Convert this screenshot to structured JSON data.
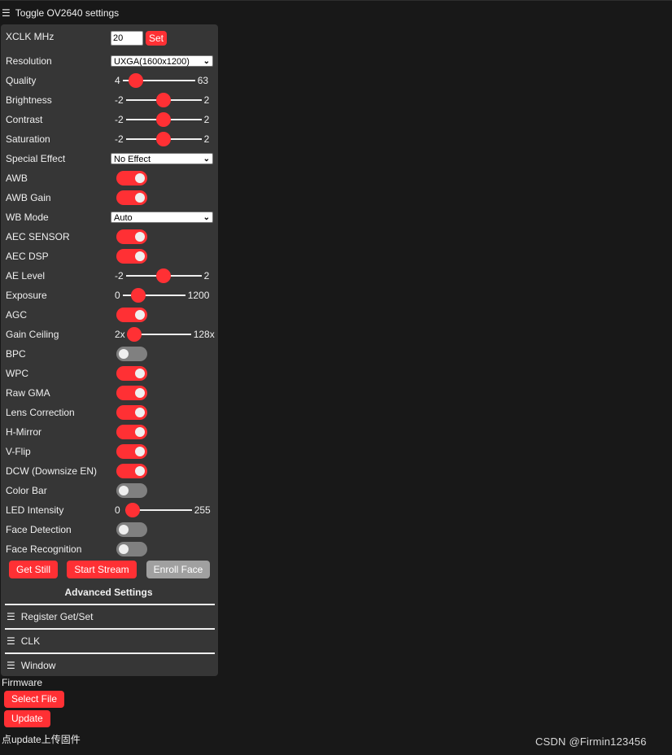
{
  "header": {
    "toggle_label": "Toggle OV2640 settings"
  },
  "xclk": {
    "label": "XCLK MHz",
    "value": "20",
    "button": "Set"
  },
  "resolution": {
    "label": "Resolution",
    "value": "UXGA(1600x1200)"
  },
  "quality": {
    "label": "Quality",
    "min": "4",
    "max": "63",
    "value": 10
  },
  "brightness": {
    "label": "Brightness",
    "min": "-2",
    "max": "2",
    "value": 0
  },
  "contrast": {
    "label": "Contrast",
    "min": "-2",
    "max": "2",
    "value": 0
  },
  "saturation": {
    "label": "Saturation",
    "min": "-2",
    "max": "2",
    "value": 0
  },
  "special_effect": {
    "label": "Special Effect",
    "value": "No Effect"
  },
  "awb": {
    "label": "AWB",
    "on": true
  },
  "awb_gain": {
    "label": "AWB Gain",
    "on": true
  },
  "wb_mode": {
    "label": "WB Mode",
    "value": "Auto"
  },
  "aec_sensor": {
    "label": "AEC SENSOR",
    "on": true
  },
  "aec_dsp": {
    "label": "AEC DSP",
    "on": true
  },
  "ae_level": {
    "label": "AE Level",
    "min": "-2",
    "max": "2",
    "value": 0
  },
  "exposure": {
    "label": "Exposure",
    "min": "0",
    "max": "1200",
    "value": 204
  },
  "agc": {
    "label": "AGC",
    "on": true
  },
  "gain_ceiling": {
    "label": "Gain Ceiling",
    "min": "2x",
    "max": "128x",
    "value": 0
  },
  "bpc": {
    "label": "BPC",
    "on": false
  },
  "wpc": {
    "label": "WPC",
    "on": true
  },
  "raw_gma": {
    "label": "Raw GMA",
    "on": true
  },
  "lens_correction": {
    "label": "Lens Correction",
    "on": true
  },
  "h_mirror": {
    "label": "H-Mirror",
    "on": true
  },
  "v_flip": {
    "label": "V-Flip",
    "on": true
  },
  "dcw": {
    "label": "DCW (Downsize EN)",
    "on": true
  },
  "color_bar": {
    "label": "Color Bar",
    "on": false
  },
  "led_intensity": {
    "label": "LED Intensity",
    "min": "0",
    "max": "255",
    "value": 0
  },
  "face_detection": {
    "label": "Face Detection",
    "on": false
  },
  "face_recognition": {
    "label": "Face Recognition",
    "on": false
  },
  "buttons": {
    "get_still": "Get Still",
    "start_stream": "Start Stream",
    "enroll_face": "Enroll Face"
  },
  "advanced": {
    "title": "Advanced Settings",
    "sections": [
      "Register Get/Set",
      "CLK",
      "Window"
    ]
  },
  "firmware": {
    "label": "Firmware",
    "select_file": "Select File",
    "update": "Update",
    "hint": "点update上传固件"
  },
  "watermark": "CSDN @Firmin123456",
  "colors": {
    "accent": "#ff3034",
    "panel": "#363636",
    "background": "#181818",
    "switch_off": "#808080",
    "disabled": "#a0a0a0"
  }
}
